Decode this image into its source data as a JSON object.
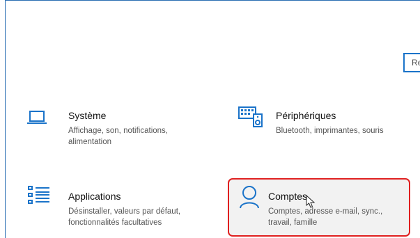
{
  "search": {
    "placeholder": "Re"
  },
  "tiles": [
    {
      "id": "systeme",
      "icon": "laptop-icon",
      "title": "Système",
      "desc": "Affichage, son, notifications, alimentation"
    },
    {
      "id": "peripheriques",
      "icon": "keyboard-speaker-icon",
      "title": "Périphériques",
      "desc": "Bluetooth, imprimantes, souris"
    },
    {
      "id": "applications",
      "icon": "apps-list-icon",
      "title": "Applications",
      "desc": "Désinstaller, valeurs par défaut, fonctionnalités facultatives"
    },
    {
      "id": "comptes",
      "icon": "person-icon",
      "title": "Comptes",
      "desc": "Comptes, adresse e-mail, sync., travail, famille"
    }
  ],
  "colors": {
    "accent": "#1a73c9",
    "highlight_border": "#e02020"
  }
}
